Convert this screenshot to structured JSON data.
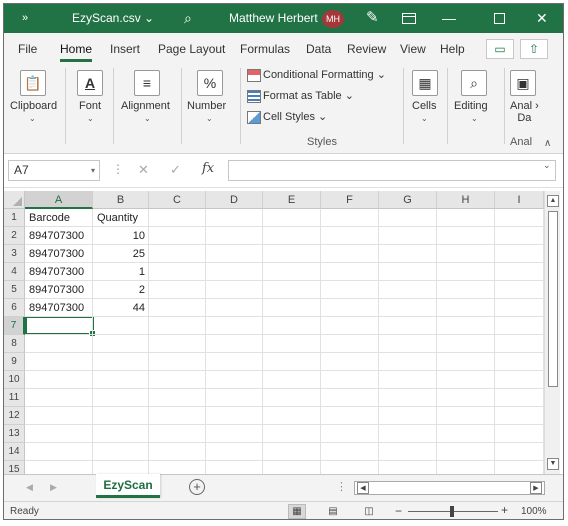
{
  "titlebar": {
    "qat_more": "»",
    "doc_title": "EzyScan.csv",
    "doc_title_caret": "⌄",
    "search_icon": "search-icon",
    "user_name": "Matthew Herbert",
    "avatar_initials": "MH",
    "accent": "#217346",
    "avatar_color": "#a4373a"
  },
  "tabs": [
    "File",
    "Home",
    "Insert",
    "Page Layout",
    "Formulas",
    "Data",
    "Review",
    "View",
    "Help"
  ],
  "active_tab": "Home",
  "ribbon": {
    "clipboard": "Clipboard",
    "font": "Font",
    "alignment": "Alignment",
    "number": "Number",
    "number_icon": "%",
    "conditional_formatting": "Conditional Formatting",
    "format_as_table": "Format as Table",
    "cell_styles": "Cell Styles",
    "styles": "Styles",
    "cells": "Cells",
    "editing": "Editing",
    "analyze_line1": "Anal",
    "analyze_line2": "Da",
    "analyze_caption": "Anal"
  },
  "formula_bar": {
    "name_box": "A7",
    "formula": "",
    "fx": "fx"
  },
  "columns": [
    "A",
    "B",
    "C",
    "D",
    "E",
    "F",
    "G",
    "H",
    "I"
  ],
  "rows": [
    "1",
    "2",
    "3",
    "4",
    "5",
    "6",
    "7",
    "8",
    "9",
    "10",
    "11",
    "12",
    "13",
    "14",
    "15"
  ],
  "sheet_cells": {
    "A1": "Barcode",
    "B1": "Quantity",
    "A2": "894707300",
    "B2": "10",
    "A3": "894707300",
    "B3": "25",
    "A4": "894707300",
    "B4": "1",
    "A5": "894707300",
    "B5": "2",
    "A6": "894707300",
    "B6": "44"
  },
  "active_cell": "A7",
  "sheet_tabs": {
    "active": "EzyScan",
    "add": "+"
  },
  "status": {
    "text": "Ready",
    "zoom": "100%",
    "zoom_minus": "−",
    "zoom_plus": "+"
  }
}
